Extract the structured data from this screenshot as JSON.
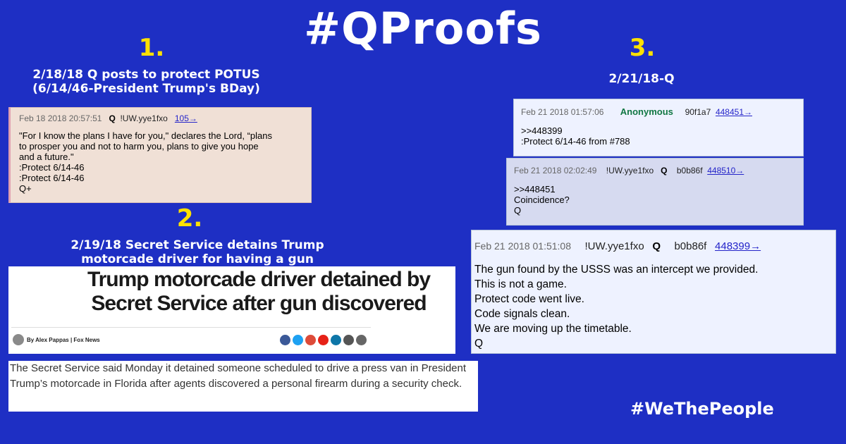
{
  "title": "#QProofs",
  "section1": {
    "number": "1.",
    "caption_line1": "2/18/18 Q posts to protect POTUS",
    "caption_line2": "(6/14/46-President Trump's BDay)",
    "post": {
      "date": "Feb 18 2018 20:57:51",
      "q": "Q",
      "trip": "!UW.yye1fxo",
      "link": "105→",
      "body": "\"For I know the plans I have for you,\" declares the Lord, “plans\nto prosper you and not to harm you, plans to give you hope\nand a future.\"\n:Protect 6/14-46\n:Protect 6/14-46\nQ+"
    }
  },
  "section2": {
    "number": "2.",
    "caption_line1": "2/19/18 Secret Service detains Trump",
    "caption_line2": "motorcade driver for having a gun",
    "headline": "Trump motorcade driver detained by Secret Service after gun discovered",
    "byline": "By Alex Pappas | Fox News",
    "social_colors": [
      "#3b5998",
      "#1da1f2",
      "#dd4b39",
      "#e62117",
      "#0e76a8",
      "#555555",
      "#666666"
    ],
    "paragraph": "The Secret Service said Monday it detained someone scheduled to drive a press van in President Trump’s motorcade in Florida after agents discovered a personal firearm during a security check."
  },
  "section3": {
    "number": "3.",
    "caption": "2/21/18-Q",
    "post_a": {
      "date": "Feb 21 2018 01:57:06",
      "name": "Anonymous",
      "id": "90f1a7",
      "link": "448451→",
      "body": ">>448399\n:Protect 6/14-46 from #788"
    },
    "post_b": {
      "date": "Feb 21 2018 02:02:49",
      "trip": "!UW.yye1fxo",
      "q": "Q",
      "id": "b0b86f",
      "link": "448510→",
      "body": ">>448451\nCoincidence?\nQ"
    },
    "post_c": {
      "date": "Feb 21 2018 01:51:08",
      "trip": "!UW.yye1fxo",
      "q": "Q",
      "id": "b0b86f",
      "link": "448399→",
      "body": "The gun found by the USSS was an intercept we provided.\nThis is not a game.\nProtect code went live.\nCode signals clean.\nWe are moving up the timetable.\nQ"
    }
  },
  "hashtag": "#WeThePeople"
}
